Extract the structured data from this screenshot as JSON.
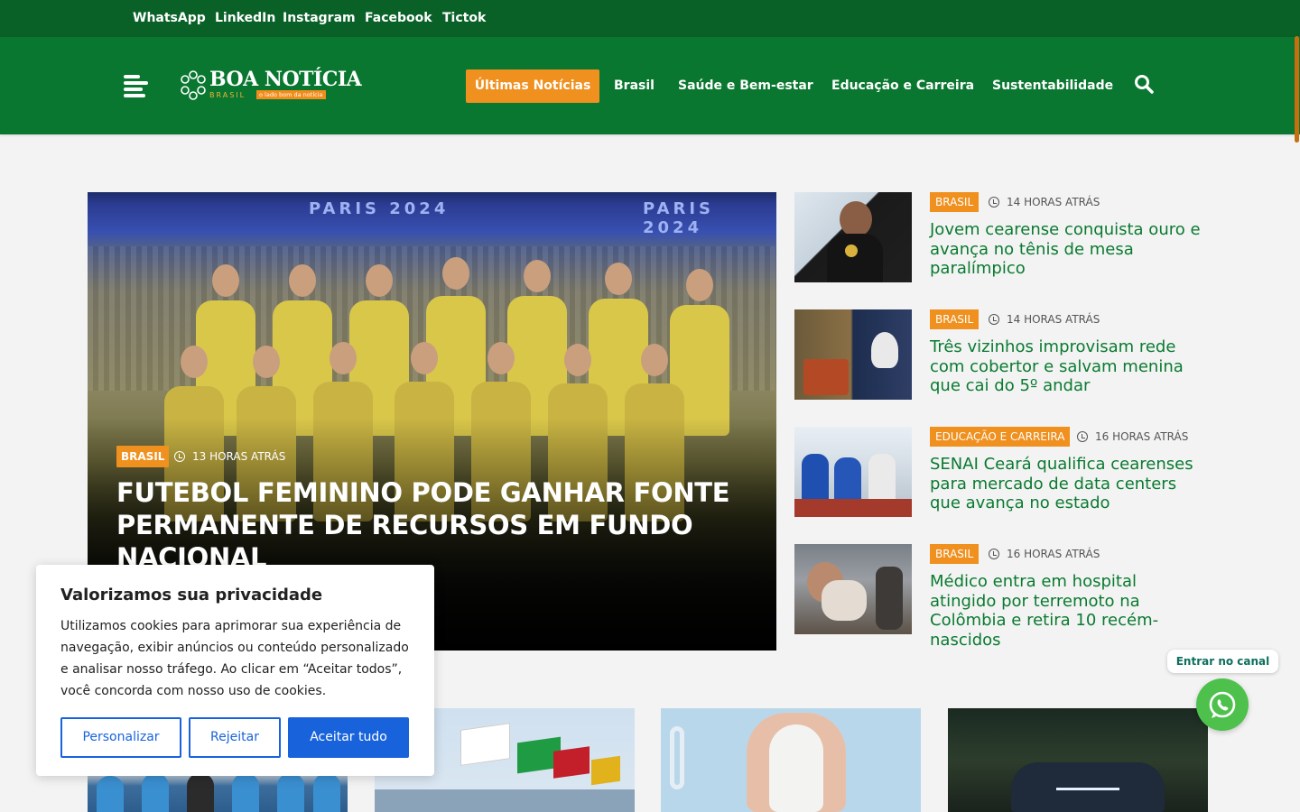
{
  "topbar": {
    "social_links": [
      "WhatsApp",
      "LinkedIn",
      "Instagram",
      "Facebook",
      "Tictok"
    ]
  },
  "header": {
    "logo": {
      "title": "BOA NOTÍCIA",
      "subtitle": "BRASIL",
      "tagline": "o lado bom da notícia"
    },
    "nav": {
      "active": "Últimas Notícias",
      "items": [
        "Brasil",
        "Saúde e Bem-estar",
        "Educação e Carreira",
        "Sustentabilidade"
      ]
    },
    "search_icon": "search-icon",
    "menu_icon": "hamburger-icon"
  },
  "colors": {
    "topbar": "#0a6128",
    "header": "#09772f",
    "accent": "#ef901f",
    "headline": "#0a7a30",
    "cookie_button": "#1863dc",
    "whatsapp": "#4dc14c"
  },
  "hero": {
    "category": "BRASIL",
    "time": "13 HORAS ATRÁS",
    "title": "Futebol feminino pode ganhar fonte permanente de recursos em fundo nacional",
    "image_text_left": "PARIS 2024",
    "image_text_right": "PARIS 2024"
  },
  "side_news": [
    {
      "category": "BRASIL",
      "time": "14 HORAS ATRÁS",
      "title": "Jovem cearense conquista ouro e avança no tênis de mesa paralímpico"
    },
    {
      "category": "BRASIL",
      "time": "14 HORAS ATRÁS",
      "title": "Três vizinhos improvisam rede com cobertor e salvam menina que cai do 5º andar"
    },
    {
      "category": "EDUCAÇÃO E CARREIRA",
      "time": "16 HORAS ATRÁS",
      "title": "SENAI Ceará qualifica cearenses para mercado de data centers que avança no estado"
    },
    {
      "category": "BRASIL",
      "time": "16 HORAS ATRÁS",
      "title": "Médico entra em hospital atingido por terremoto na Colômbia e retira 10 recém-nascidos"
    }
  ],
  "cookie": {
    "title": "Valorizamos sua privacidade",
    "text": "Utilizamos cookies para aprimorar sua experiência de navegação, exibir anúncios ou conteúdo personalizado e analisar nosso tráfego. Ao clicar em “Aceitar todos”, você concorda com nosso uso de cookies.",
    "customize": "Personalizar",
    "reject": "Rejeitar",
    "accept": "Aceitar tudo"
  },
  "whatsapp": {
    "label": "Entrar no canal"
  }
}
